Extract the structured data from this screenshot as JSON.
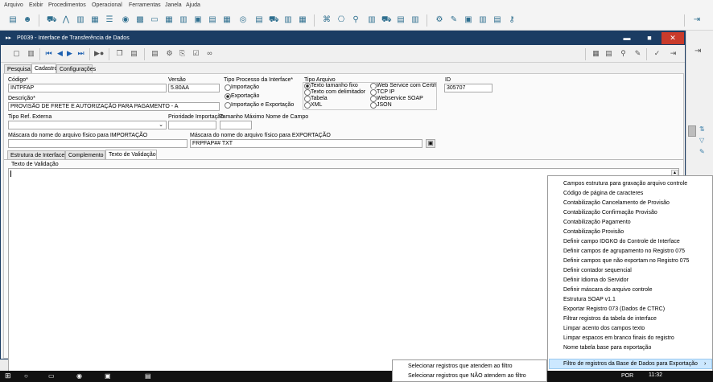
{
  "menubar": [
    "Arquivo",
    "Exibir",
    "Procedimentos",
    "Operacional",
    "Ferramentas",
    "Janela",
    "Ajuda"
  ],
  "window": {
    "title": "P0039 - Interface de Transferência de Dados"
  },
  "tabs_main": [
    "Pesquisa",
    "Cadastro",
    "Configurações"
  ],
  "form": {
    "codigo_label": "Código*",
    "codigo_value": "INTPFAP",
    "versao_label": "Versão",
    "versao_value": "5.80AA",
    "descricao_label": "Descrição*",
    "descricao_value": "PROVISÃO DE FRETE E AUTORIZAÇÃO PARA PAGAMENTO - A",
    "tipo_processo_label": "Tipo Processo da Interface*",
    "tipo_processo_options": [
      "Importação",
      "Exportação",
      "Importação e Exportação"
    ],
    "tipo_arquivo_label": "Tipo Arquivo",
    "tipo_arquivo_col1": [
      "Texto tamanho fixo",
      "Texto com delimitador",
      "Tabela",
      "XML"
    ],
    "tipo_arquivo_col2": [
      "Web Service com Certificado",
      "TCP IP",
      "Webservice SOAP",
      "JSON"
    ],
    "id_label": "ID",
    "id_value": "305707",
    "tipo_ref_label": "Tipo Ref. Externa",
    "prioridade_label": "Prioridade Importação",
    "tamanho_label": "Tamanho Máximo Nome de Campo",
    "mascara_imp_label": "Máscara do nome do arquivo físico para IMPORTAÇÃO",
    "mascara_exp_label": "Máscara do nome do arquivo físico para EXPORTAÇÃO",
    "mascara_exp_value": "FRPFAP## TXT"
  },
  "tabs_sub": [
    "Estrutura de Interface",
    "Complemento",
    "Texto de Validação"
  ],
  "texto_validacao_label": "Texto de Validação",
  "context_menu": [
    "Campos estrutura para gravação arquivo controle",
    "Código de página de caracteres",
    "Contabilização Cancelamento de Provisão",
    "Contabilização Confirmação Provisão",
    "Contabilização Pagamento",
    "Contabilização Provisão",
    "Definir campo IDGKO do Controle de Interface",
    "Definir campos de agrupamento no Registro 075",
    "Definir campos que não exportam no Registro 075",
    "Definir contador sequencial",
    "Definir Idioma do Servidor",
    "Definir máscara do arquivo controle",
    "Estrutura SOAP v1.1",
    "Exportar Registro 073 (Dados de CTRC)",
    "Filtrar registros da tabela de interface",
    "Limpar acento dos campos texto",
    "Limpar espacos em branco finais do registro",
    "Nome tabela base para exportação",
    "Filtro de registros da Base de Dados para Exportação"
  ],
  "submenu": [
    "Selecionar registros que atendem ao filtro",
    "Selecionar registros que NÃO atendem ao filtro"
  ],
  "taskbar": {
    "lang": "POR",
    "time": "11:32"
  }
}
